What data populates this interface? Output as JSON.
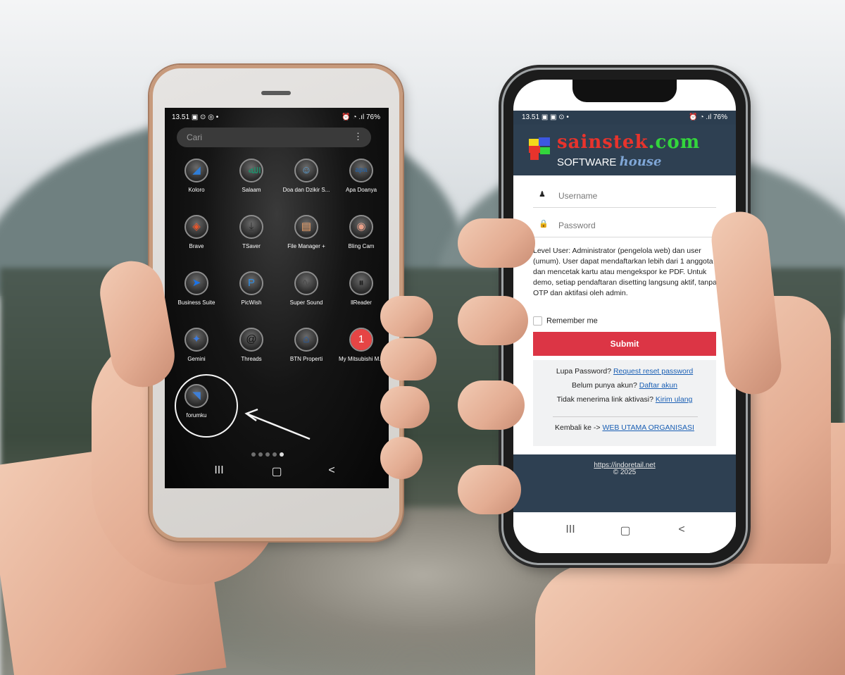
{
  "left_phone": {
    "status_time": "13.51",
    "status_icons": "▣ ⊙ ◎ •",
    "status_right": "⏰ ◔ .ıl 76%",
    "search_placeholder": "Cari",
    "menu_glyph": "⋮",
    "apps": [
      {
        "label": "Koloro",
        "glyph": "◢",
        "color": "#2f7dd6"
      },
      {
        "label": "Salaam",
        "glyph": "ﷲ",
        "color": "#1f8f6b"
      },
      {
        "label": "Doa dan Dzikir S...",
        "glyph": "☺",
        "color": "#5aa0d4"
      },
      {
        "label": "Apa Doanya",
        "glyph": "apa",
        "color": "#2c5f96"
      },
      {
        "label": "Brave",
        "glyph": "◈",
        "color": "#e8552a"
      },
      {
        "label": "TSaver",
        "glyph": "⤓",
        "color": "#2a2a2a"
      },
      {
        "label": "File Manager +",
        "glyph": "▤",
        "color": "#f0a36a"
      },
      {
        "label": "Bling Cam",
        "glyph": "◉",
        "color": "#e9a089"
      },
      {
        "label": "Business Suite",
        "glyph": "➤",
        "color": "#1b73e8"
      },
      {
        "label": "PicWish",
        "glyph": "P",
        "color": "#2f8de4"
      },
      {
        "label": "Super Sound",
        "glyph": "∿",
        "color": "#4b4b4b"
      },
      {
        "label": "llReader",
        "glyph": "⏸",
        "color": "#1c1c1c"
      },
      {
        "label": "Gemini",
        "glyph": "✦",
        "color": "#3b7be0"
      },
      {
        "label": "Threads",
        "glyph": "@",
        "color": "#111111"
      },
      {
        "label": "BTN Properti",
        "glyph": "⌂",
        "color": "#1c5bb0"
      },
      {
        "label": "My Mitsubishi M...",
        "glyph": "▦",
        "color": "#8e2a2a",
        "badge": "1"
      },
      {
        "label": "forumku",
        "glyph": "◥",
        "color": "#3f7fd6"
      }
    ],
    "nav": {
      "recents": "III",
      "home": "▢",
      "back": "<"
    }
  },
  "right_phone": {
    "status_time": "13.51",
    "status_icons": "▣ ▣ ⊙ •",
    "status_right": "⏰ ◔ .ıl 76%",
    "logo_part1": "sainstek",
    "logo_part2": ".com",
    "logo_sub": "SOFTWARE",
    "logo_sub_italic": "house",
    "username_placeholder": "Username",
    "password_placeholder": "Password",
    "username_icon": "person-icon",
    "password_icon": "lock-icon",
    "info_text": "Level User: Administrator (pengelola web) dan user (umum). User dapat mendaftarkan lebih dari 1 anggota dan mencetak kartu atau mengekspor ke PDF. Untuk demo, setiap pendaftaran disetting langsung aktif, tanpa OTP dan aktifasi oleh admin.",
    "remember_label": "Remember me",
    "submit_label": "Submit",
    "forgot_text": "Lupa Password?",
    "forgot_link": "Request reset password",
    "register_text": "Belum punya akun?",
    "register_link": "Daftar akun",
    "resend_text": "Tidak menerima link aktivasi?",
    "resend_link": "Kirim ulang",
    "back_text": "Kembali ke ->",
    "back_link": "WEB UTAMA ORGANISASI",
    "footer_text": "© 2025",
    "footer_link": "https://indoretail.net",
    "nav": {
      "recents": "III",
      "home": "▢",
      "back": "<"
    },
    "colors": {
      "header_bg": "#2e4052",
      "submit_bg": "#dc3545",
      "link": "#1a5fb4"
    }
  }
}
